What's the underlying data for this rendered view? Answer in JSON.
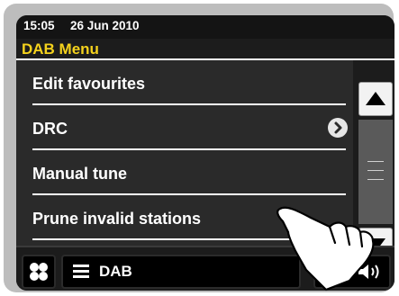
{
  "status": {
    "time": "15:05",
    "date": "26 Jun 2010"
  },
  "menu": {
    "title": "DAB Menu",
    "items": [
      {
        "label": "Edit favourites",
        "has_submenu": false
      },
      {
        "label": "DRC",
        "has_submenu": true
      },
      {
        "label": "Manual tune",
        "has_submenu": false
      },
      {
        "label": "Prune invalid stations",
        "has_submenu": false
      }
    ]
  },
  "bottom": {
    "source_label": "DAB"
  },
  "icons": {
    "scroll_up": "triangle-up-icon",
    "scroll_down": "triangle-down-icon",
    "home": "four-petal-home-icon",
    "source": "list-icon",
    "volume": "speaker-icon",
    "submenu": "chevron-right-icon",
    "pointer": "pointing-hand-icon"
  },
  "colors": {
    "title": "#f5d21c",
    "screen_bg": "#1c1c1c",
    "menu_bg": "#2a2a2a"
  }
}
